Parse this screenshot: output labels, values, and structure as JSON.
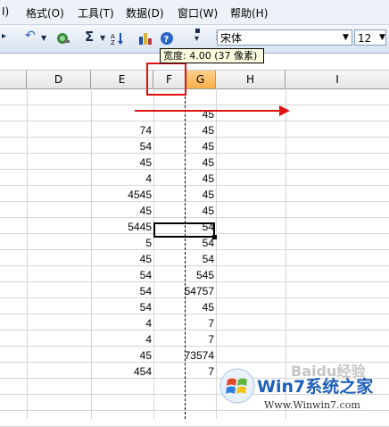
{
  "menubar": {
    "items": [
      {
        "label": "I)"
      },
      {
        "label": "格式(O)"
      },
      {
        "label": "工具(T)"
      },
      {
        "label": "数据(D)"
      },
      {
        "label": "窗口(W)"
      },
      {
        "label": "帮助(H)"
      }
    ]
  },
  "toolbar": {
    "font_name": "宋体",
    "font_size": "12",
    "sigma": "Σ"
  },
  "tooltip": {
    "text": "宽度: 4.00 (37 像素)"
  },
  "columns": [
    "D",
    "E",
    "F",
    "G",
    "H",
    "I"
  ],
  "selected_column": "G",
  "rows": [
    {
      "E": "",
      "G": "45"
    },
    {
      "E": "74",
      "G": "45"
    },
    {
      "E": "54",
      "G": "45"
    },
    {
      "E": "45",
      "G": "45"
    },
    {
      "E": "4",
      "G": "45"
    },
    {
      "E": "4545",
      "G": "45"
    },
    {
      "E": "45",
      "G": "45"
    },
    {
      "E": "5445",
      "G": "54"
    },
    {
      "E": "5",
      "G": "54"
    },
    {
      "E": "45",
      "G": "54"
    },
    {
      "E": "54",
      "G": "545"
    },
    {
      "E": "54",
      "G": "54757"
    },
    {
      "E": "54",
      "G": "45"
    },
    {
      "E": "4",
      "G": "7"
    },
    {
      "E": "4",
      "G": "7"
    },
    {
      "E": "45",
      "G": "73574"
    },
    {
      "E": "454",
      "G": "7"
    }
  ],
  "watermark": {
    "brand": "Baidu经验",
    "site_cn": "Win7系统之家",
    "site_url": "Www.Winwin7.com"
  }
}
